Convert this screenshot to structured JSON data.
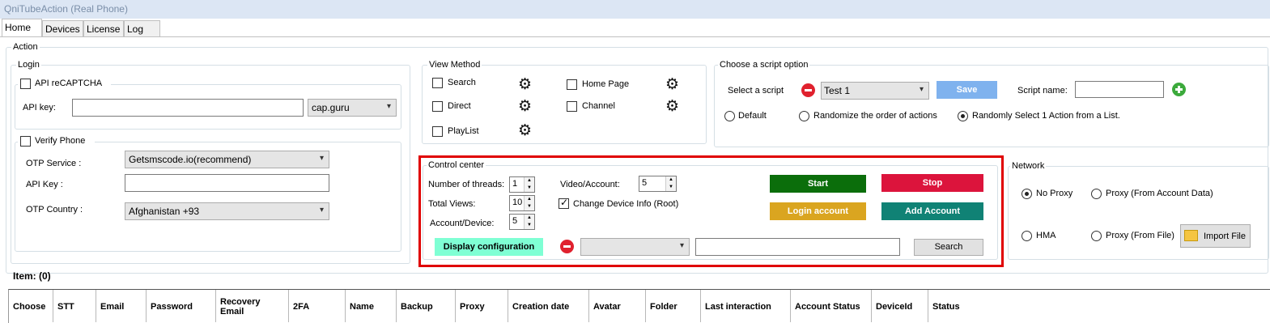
{
  "window": {
    "title": "QniTubeAction (Real Phone)"
  },
  "tabs": [
    "Home",
    "Devices",
    "License",
    "Log"
  ],
  "action_group": "Action",
  "login": {
    "title": "Login",
    "recaptcha": {
      "label": "API reCAPTCHA",
      "api_key_label": "API key:",
      "api_key_value": "",
      "provider": "cap.guru"
    },
    "verify_phone": {
      "label": "Verify Phone",
      "otp_service_label": "OTP Service :",
      "otp_service_value": "Getsmscode.io(recommend)",
      "api_key_label": "API Key :",
      "api_key_value": "",
      "otp_country_label": "OTP Country :",
      "otp_country_value": "Afghanistan +93"
    }
  },
  "view_method": {
    "title": "View Method",
    "search": "Search",
    "home_page": "Home Page",
    "direct": "Direct",
    "channel": "Channel",
    "playlist": "PlayList"
  },
  "script_option": {
    "title": "Choose a script option",
    "select_label": "Select a script",
    "selected": "Test 1",
    "save": "Save",
    "name_label": "Script name:",
    "name_value": "",
    "default": "Default",
    "randomize": "Randomize the order of actions",
    "random_one": "Randomly Select 1 Action from a List."
  },
  "control_center": {
    "title": "Control center",
    "threads_label": "Number of threads:",
    "threads": "1",
    "views_label": "Total Views:",
    "views": "10",
    "acct_device_label": "Account/Device:",
    "acct_device": "5",
    "video_acct_label": "Video/Account:",
    "video_acct": "5",
    "change_device": "Change Device Info (Root)",
    "start": "Start",
    "stop": "Stop",
    "login_account": "Login account",
    "add_account": "Add Account",
    "display_config": "Display configuration",
    "filter_value": "",
    "search_value": "",
    "search_btn": "Search"
  },
  "network": {
    "title": "Network",
    "no_proxy": "No Proxy",
    "proxy_account": "Proxy (From Account Data)",
    "hma": "HMA",
    "proxy_file": "Proxy (From File)",
    "import_file": "Import File"
  },
  "items_label": "Item: (0)",
  "table": {
    "columns": [
      "Choose",
      "STT",
      "Email",
      "Password",
      "Recovery Email",
      "2FA",
      "Name",
      "Backup",
      "Proxy",
      "Creation date",
      "Avatar",
      "Folder",
      "Last interaction",
      "Account Status",
      "DeviceId",
      "Status"
    ]
  },
  "colors": {
    "start": "#0b6e0b",
    "stop": "#dc143c",
    "login_account": "#daa520",
    "add_account": "#108275",
    "save": "#7fb2ee",
    "display_config": "#7fffd4",
    "highlight": "#e00000"
  }
}
